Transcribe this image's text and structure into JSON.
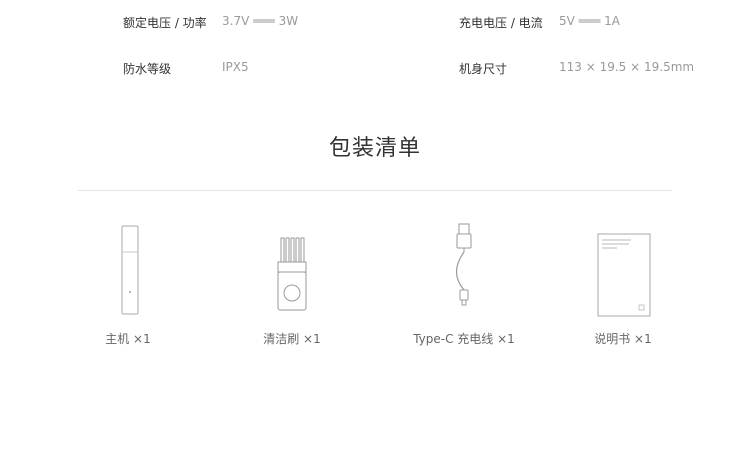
{
  "specs": [
    {
      "label": "额定电压 / 功率",
      "value": "3.7V ═══ 3W"
    },
    {
      "label": "充电电压 / 电流",
      "value": "5V ═══ 1A"
    },
    {
      "label": "防水等级",
      "value": "IPX5"
    },
    {
      "label": "机身尺寸",
      "value": "113 × 19.5 × 19.5mm"
    }
  ],
  "package": {
    "title": "包装清单",
    "items": [
      {
        "label": "主机 ×1",
        "icon": "trimmer-icon"
      },
      {
        "label": "清洁刷 ×1",
        "icon": "cleaning-brush-icon"
      },
      {
        "label": "Type-C 充电线 ×1",
        "icon": "usb-cable-icon"
      },
      {
        "label": "说明书 ×1",
        "icon": "manual-icon"
      }
    ]
  }
}
